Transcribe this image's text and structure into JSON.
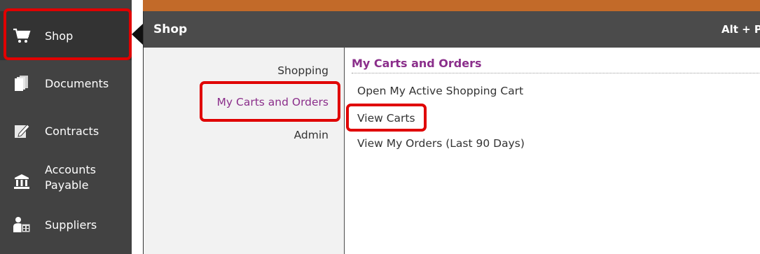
{
  "sidebar": {
    "items": [
      {
        "label": "Shop",
        "icon": "cart-icon"
      },
      {
        "label": "Documents",
        "icon": "documents-icon"
      },
      {
        "label": "Contracts",
        "icon": "contract-icon"
      },
      {
        "label": "Accounts Payable",
        "label_line1": "Accounts",
        "label_line2": "Payable",
        "icon": "bank-icon"
      },
      {
        "label": "Suppliers",
        "icon": "suppliers-icon"
      }
    ]
  },
  "flyout": {
    "title": "Shop",
    "shortcut": "Alt + P",
    "categories": [
      "Shopping",
      "My Carts and Orders",
      "Admin"
    ],
    "section_title": "My Carts and Orders",
    "links": [
      "Open My Active Shopping Cart",
      "View Carts",
      "View My Orders (Last 90 Days)"
    ]
  },
  "colors": {
    "sidebar_bg": "#424242",
    "accent_purple": "#8b2f8b",
    "highlight_red": "#e00000",
    "header_bg": "#4b4b4b"
  }
}
